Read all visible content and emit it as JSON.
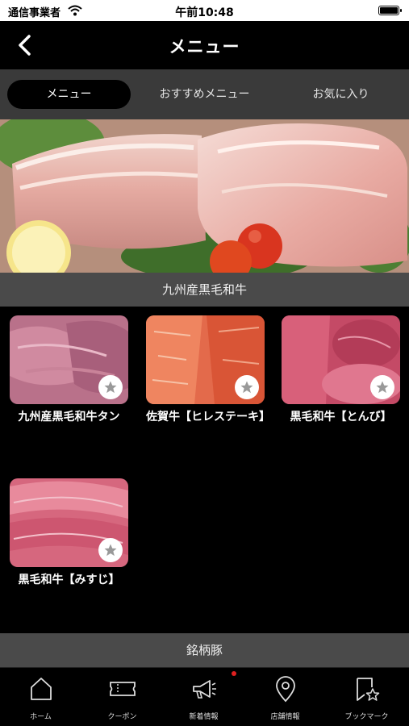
{
  "status_bar": {
    "carrier": "通信事業者",
    "time": "午前10:48"
  },
  "nav": {
    "title": "メニュー"
  },
  "tabs": [
    {
      "label": "メニュー",
      "active": true
    },
    {
      "label": "おすすめメニュー",
      "active": false
    },
    {
      "label": "お気に入り",
      "active": false
    }
  ],
  "sections": [
    {
      "title": "九州産黒毛和牛"
    },
    {
      "title": "銘柄豚"
    }
  ],
  "items": [
    {
      "name": "九州産黒毛和牛タン"
    },
    {
      "name": "佐賀牛【ヒレステーキ】"
    },
    {
      "name": "黒毛和牛【とんび】"
    },
    {
      "name": "黒毛和牛【みすじ】"
    }
  ],
  "tabbar": [
    {
      "label": "ホーム",
      "icon": "home-icon"
    },
    {
      "label": "クーポン",
      "icon": "coupon-icon"
    },
    {
      "label": "新着情報",
      "icon": "megaphone-icon"
    },
    {
      "label": "店舗情報",
      "icon": "map-pin-icon"
    },
    {
      "label": "ブックマーク",
      "icon": "bookmark-star-icon"
    }
  ],
  "colors": {
    "background": "#000000",
    "tab_strip": "#3a3a3a",
    "section_header": "#4a4a4a",
    "notification": "#e02020"
  }
}
